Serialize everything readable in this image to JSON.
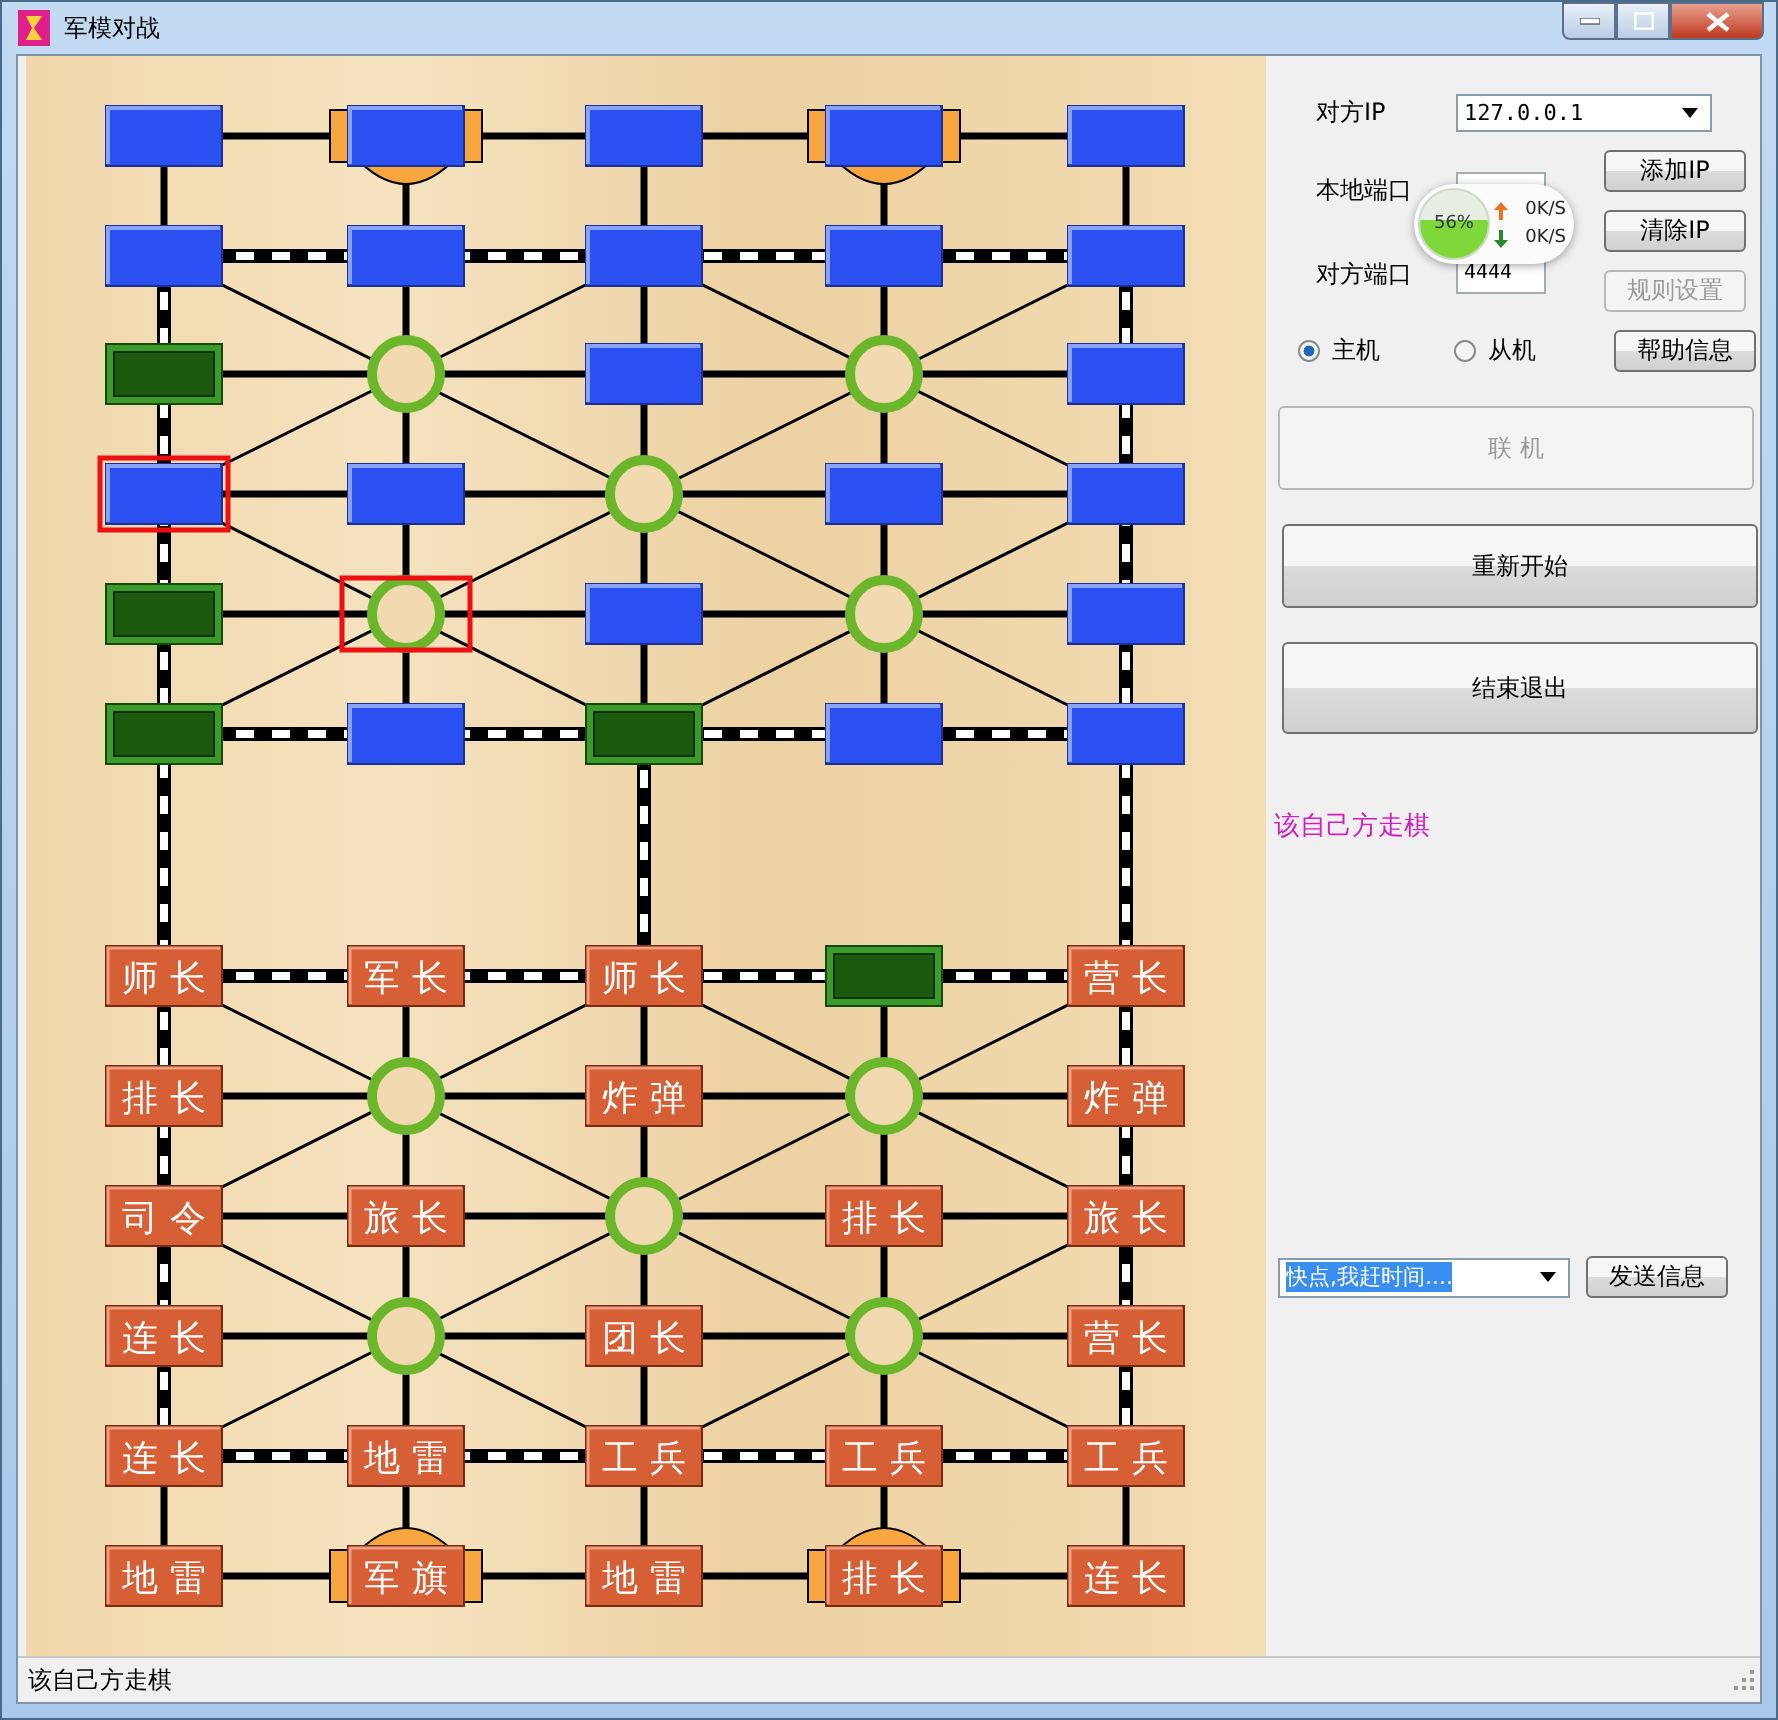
{
  "window": {
    "title": "军模对战"
  },
  "board": {
    "rows": [
      [
        {
          "kind": "blue",
          "hq": false,
          "selected": false
        },
        {
          "kind": "blue",
          "hq": true,
          "selected": false
        },
        {
          "kind": "blue",
          "hq": false,
          "selected": false
        },
        {
          "kind": "blue",
          "hq": true,
          "selected": false
        },
        {
          "kind": "blue",
          "hq": false,
          "selected": false
        }
      ],
      [
        {
          "kind": "blue",
          "hq": false,
          "selected": false
        },
        {
          "kind": "blue",
          "hq": false,
          "selected": false
        },
        {
          "kind": "blue",
          "hq": false,
          "selected": false
        },
        {
          "kind": "blue",
          "hq": false,
          "selected": false
        },
        {
          "kind": "blue",
          "hq": false,
          "selected": false
        }
      ],
      [
        {
          "kind": "green",
          "hq": false,
          "selected": false
        },
        {
          "kind": "camp",
          "hq": false,
          "selected": false
        },
        {
          "kind": "blue",
          "hq": false,
          "selected": false
        },
        {
          "kind": "camp",
          "hq": false,
          "selected": false
        },
        {
          "kind": "blue",
          "hq": false,
          "selected": false
        }
      ],
      [
        {
          "kind": "blue",
          "hq": false,
          "selected": true
        },
        {
          "kind": "blue",
          "hq": false,
          "selected": false
        },
        {
          "kind": "camp",
          "hq": false,
          "selected": false
        },
        {
          "kind": "blue",
          "hq": false,
          "selected": false
        },
        {
          "kind": "blue",
          "hq": false,
          "selected": false
        }
      ],
      [
        {
          "kind": "green",
          "hq": false,
          "selected": false
        },
        {
          "kind": "camp",
          "hq": false,
          "selected": true
        },
        {
          "kind": "blue",
          "hq": false,
          "selected": false
        },
        {
          "kind": "camp",
          "hq": false,
          "selected": false
        },
        {
          "kind": "blue",
          "hq": false,
          "selected": false
        }
      ],
      [
        {
          "kind": "green",
          "hq": false,
          "selected": false
        },
        {
          "kind": "blue",
          "hq": false,
          "selected": false
        },
        {
          "kind": "green",
          "hq": false,
          "selected": false
        },
        {
          "kind": "blue",
          "hq": false,
          "selected": false
        },
        {
          "kind": "blue",
          "hq": false,
          "selected": false
        }
      ],
      [
        {
          "kind": "red",
          "label": "师 长",
          "hq": false,
          "selected": false
        },
        {
          "kind": "red",
          "label": "军 长",
          "hq": false,
          "selected": false
        },
        {
          "kind": "red",
          "label": "师 长",
          "hq": false,
          "selected": false
        },
        {
          "kind": "green",
          "hq": false,
          "selected": false
        },
        {
          "kind": "red",
          "label": "营 长",
          "hq": false,
          "selected": false
        }
      ],
      [
        {
          "kind": "red",
          "label": "排 长",
          "hq": false,
          "selected": false
        },
        {
          "kind": "camp",
          "hq": false,
          "selected": false
        },
        {
          "kind": "red",
          "label": "炸 弹",
          "hq": false,
          "selected": false
        },
        {
          "kind": "camp",
          "hq": false,
          "selected": false
        },
        {
          "kind": "red",
          "label": "炸 弹",
          "hq": false,
          "selected": false
        }
      ],
      [
        {
          "kind": "red",
          "label": "司 令",
          "hq": false,
          "selected": false
        },
        {
          "kind": "red",
          "label": "旅 长",
          "hq": false,
          "selected": false
        },
        {
          "kind": "camp",
          "hq": false,
          "selected": false
        },
        {
          "kind": "red",
          "label": "排 长",
          "hq": false,
          "selected": false
        },
        {
          "kind": "red",
          "label": "旅 长",
          "hq": false,
          "selected": false
        }
      ],
      [
        {
          "kind": "red",
          "label": "连 长",
          "hq": false,
          "selected": false
        },
        {
          "kind": "camp",
          "hq": false,
          "selected": false
        },
        {
          "kind": "red",
          "label": "团 长",
          "hq": false,
          "selected": false
        },
        {
          "kind": "camp",
          "hq": false,
          "selected": false
        },
        {
          "kind": "red",
          "label": "营 长",
          "hq": false,
          "selected": false
        }
      ],
      [
        {
          "kind": "red",
          "label": "连 长",
          "hq": false,
          "selected": false
        },
        {
          "kind": "red",
          "label": "地 雷",
          "hq": false,
          "selected": false
        },
        {
          "kind": "red",
          "label": "工 兵",
          "hq": false,
          "selected": false
        },
        {
          "kind": "red",
          "label": "工 兵",
          "hq": false,
          "selected": false
        },
        {
          "kind": "red",
          "label": "工 兵",
          "hq": false,
          "selected": false
        }
      ],
      [
        {
          "kind": "red",
          "label": "地 雷",
          "hq": false,
          "selected": false
        },
        {
          "kind": "red",
          "label": "军 旗",
          "hq": true,
          "selected": false
        },
        {
          "kind": "red",
          "label": "地 雷",
          "hq": false,
          "selected": false
        },
        {
          "kind": "red",
          "label": "排 长",
          "hq": true,
          "selected": false
        },
        {
          "kind": "red",
          "label": "连 长",
          "hq": false,
          "selected": false
        }
      ]
    ]
  },
  "panel": {
    "peer_ip": {
      "label": "对方IP",
      "value": "127.0.0.1"
    },
    "local_port": {
      "label": "本地端口"
    },
    "peer_port": {
      "label": "对方端口",
      "value": "4444"
    },
    "buttons": [
      {
        "label": "添加IP",
        "disabled": false
      },
      {
        "label": "清除IP",
        "disabled": false
      },
      {
        "label": "规则设置",
        "disabled": true
      }
    ],
    "radios": [
      {
        "label": "主机",
        "selected": true
      },
      {
        "label": "从机",
        "selected": false
      }
    ],
    "help_button": "帮助信息",
    "connect_button": {
      "label": "联 机",
      "disabled": true
    },
    "restart_button": "重新开始",
    "quit_button": "结束退出",
    "message": "该自己方走棋",
    "chat": {
      "value": "快点,我赶时间....",
      "button": "发送信息"
    }
  },
  "speed_widget": {
    "percent": "56%",
    "up": "0K/S",
    "down": "0K/S"
  },
  "status_bar": "该自己方走棋"
}
